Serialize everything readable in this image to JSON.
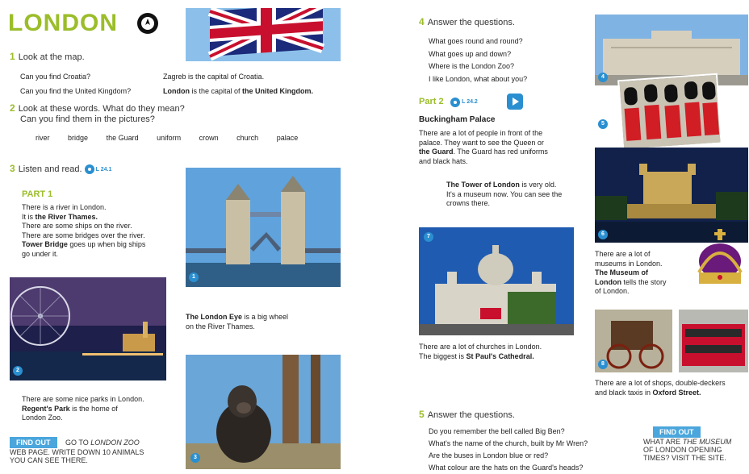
{
  "left": {
    "title": "LONDON",
    "ex1": {
      "num": "1",
      "heading": "Look at the map.",
      "q1": "Can you find Croatia?",
      "a1": "Zagreb is the capital of Croatia.",
      "q2": "Can you find the United Kingdom?",
      "a2_b1": "London",
      "a2_mid": " is the capital of ",
      "a2_b2": "the United Kingdom."
    },
    "ex2": {
      "num": "2",
      "heading1": "Look at these words. What do they mean?",
      "heading2": "Can you find them in the pictures?",
      "words": [
        "river",
        "bridge",
        "the Guard",
        "uniform",
        "crown",
        "church",
        "palace"
      ]
    },
    "ex3": {
      "num": "3",
      "heading": "Listen and read.",
      "code": "L 24.1"
    },
    "part1": {
      "label": "PART 1",
      "l1": "There is a river in London.",
      "l2a": "It is ",
      "l2b": "the River Thames.",
      "l3": "There are some ships on the river.",
      "l4": "There are some bridges over the river.",
      "l5b": "Tower Bridge",
      "l5": " goes up when big ships",
      "l6": "go under it."
    },
    "eye": {
      "b": "The London Eye",
      "t1": " is a big wheel",
      "t2": "on the River Thames."
    },
    "parks": {
      "l1": "There are some nice parks in London.",
      "l2b": "Regent's Park",
      "l2": " is the home of",
      "l3": "London Zoo."
    },
    "findout": {
      "label": "FIND OUT",
      "t1a": "GO TO ",
      "t1b": "LONDON ZOO",
      "t2": "WEB PAGE. WRITE DOWN 10 ANIMALS",
      "t3": "YOU CAN SEE THERE."
    },
    "badges": [
      "1",
      "2",
      "3"
    ]
  },
  "right": {
    "ex4": {
      "num": "4",
      "heading": "Answer the questions.",
      "qs": [
        "What goes round and round?",
        "What goes up and down?",
        "Where is the London Zoo?",
        "I like London, what about you?"
      ]
    },
    "part2": {
      "label": "Part 2",
      "code": "L 24.2",
      "title": "Buckingham Palace",
      "l1": "There are a lot of people in front of the",
      "l2": "palace. They want to see the Queen or",
      "l3b": "the Guard",
      "l3": ". The Guard has red uniforms",
      "l4": "and black hats."
    },
    "tower": {
      "b": "The Tower of London",
      "t1": " is very old.",
      "t2": "It's a museum now. You can see the",
      "t3": "crowns there."
    },
    "church": {
      "l1": "There are a lot of churches in London.",
      "l2a": "The biggest is ",
      "l2b": "St Paul's Cathedral."
    },
    "museums": {
      "l1": "There are a lot of",
      "l2": "museums in London.",
      "l3b": "The Museum of",
      "l4b": "London",
      "l4": " tells the story",
      "l5": "of London."
    },
    "shops": {
      "l1": "There are a lot of shops, double-deckers",
      "l2a": "and black taxis in ",
      "l2b": "Oxford Street."
    },
    "ex5": {
      "num": "5",
      "heading": "Answer the questions.",
      "qs": [
        "Do you remember the bell called Big Ben?",
        "What's the name of the church, built by Mr Wren?",
        "Are the buses in London blue or red?",
        "What colour are the hats on the Guard's heads?"
      ]
    },
    "findout": {
      "label": "FIND OUT",
      "t1a": "WHAT ARE ",
      "t1b": "THE MUSEUM",
      "t2": "OF LONDON OPENING",
      "t3": "TIMES? VISIT THE SITE."
    },
    "badges": [
      "4",
      "5",
      "6",
      "7",
      "8"
    ]
  }
}
